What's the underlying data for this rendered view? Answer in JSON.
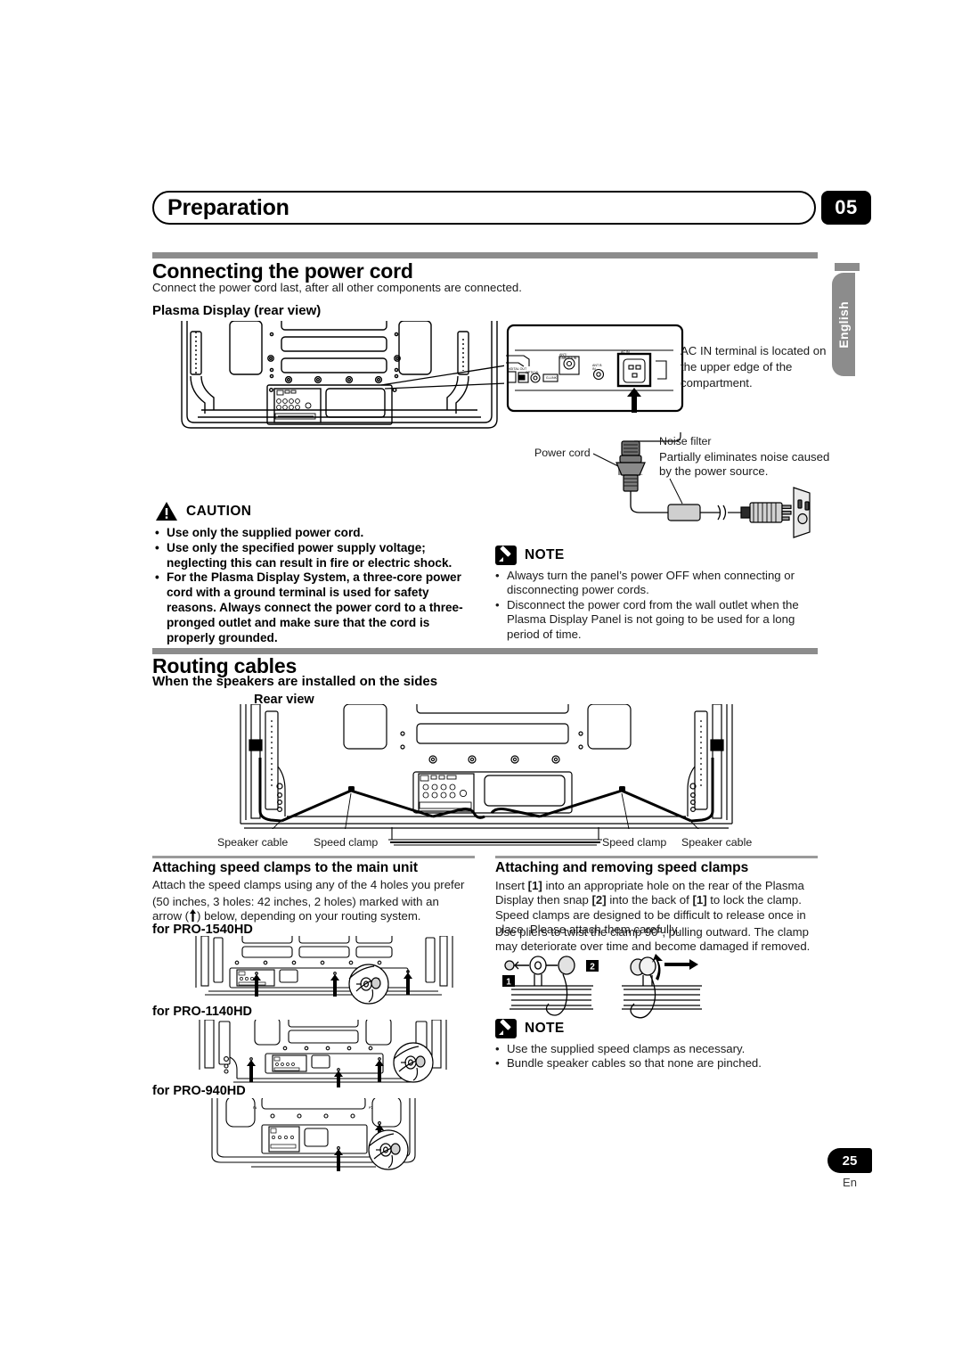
{
  "header": {
    "chapter_title": "Preparation",
    "chapter_number": "05",
    "language_tab": "English"
  },
  "section_power": {
    "heading": "Connecting the power cord",
    "intro": "Connect the power cord last, after all other components are connected.",
    "figure_label": "Plasma Display (rear view)",
    "callouts": {
      "ac_in": "AC IN terminal is located on the upper edge of the compartment.",
      "power_cord": "Power cord",
      "noise_filter_title": "Noise filter",
      "noise_filter_desc": "Partially eliminates noise caused by the power source.",
      "ac_in_port_label": "AC IN"
    }
  },
  "caution": {
    "title": "CAUTION",
    "items": [
      "Use only the supplied power cord.",
      "Use only the specified power supply voltage; neglecting this can result in fire or electric shock.",
      "For the Plasma Display System, a three-core power cord with a ground terminal is used for safety reasons. Always connect the power cord to a three-pronged outlet and make sure that the cord is properly grounded."
    ]
  },
  "note_power": {
    "title": "NOTE",
    "items": [
      "Always turn the panel’s power OFF when connecting or disconnecting power cords.",
      "Disconnect the power cord from the wall outlet when the Plasma Display Panel is not going to be used for a long period of time."
    ]
  },
  "section_routing": {
    "heading": "Routing cables",
    "subheading": "When the speakers are installed on the sides",
    "view_label": "Rear view",
    "labels": {
      "speaker_cable_left": "Speaker cable",
      "speed_clamp_left": "Speed clamp",
      "speed_clamp_right": "Speed clamp",
      "speaker_cable_right": "Speaker cable"
    }
  },
  "attaching": {
    "heading": "Attaching speed clamps to the main unit",
    "para1": "Attach the speed clamps using any of the 4 holes you prefer",
    "para2_pre": "(50 inches, 3 holes: 42 inches, 2 holes) marked with an arrow (",
    "para2_post": ") below, depending on your routing system.",
    "model1": "for PRO-1540HD",
    "model2": "for PRO-1140HD",
    "model3": "for PRO-940HD"
  },
  "removing": {
    "heading": "Attaching and removing speed clamps",
    "para_a_1": "Insert ",
    "para_a_tag1": "1",
    "para_a_2": " into an appropriate hole on the rear of the Plasma Display then snap ",
    "para_a_tag2": "2",
    "para_a_3": " into the back of ",
    "para_a_tag3": "1",
    "para_a_4": " to lock the clamp. Speed clamps are designed to be difficult to release once in place. Please attach them carefully.",
    "para_b": "Use pliers to twist the clamp 90º, pulling outward. The clamp may deteriorate over time and become damaged if removed.",
    "step1_label": "1",
    "step2_label": "2"
  },
  "note_clamps": {
    "title": "NOTE",
    "items": [
      "Use the supplied speed clamps as necessary.",
      "Bundle speaker cables so that none are pinched."
    ]
  },
  "footer": {
    "page_number": "25",
    "language_code": "En"
  },
  "colors": {
    "rule_gray": "#8c8c8c",
    "ink": "#000000",
    "body_ink": "#1a1a1a"
  }
}
